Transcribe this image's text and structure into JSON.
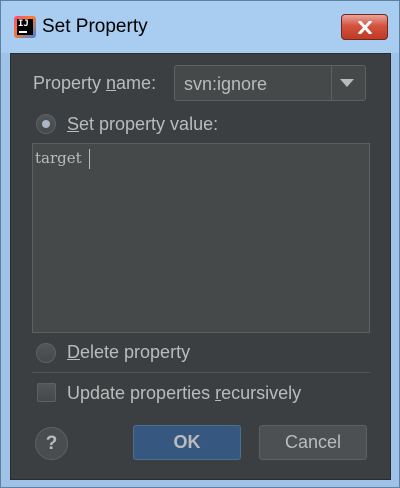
{
  "window": {
    "title": "Set Property",
    "app_icon_text": "IJ",
    "close_icon": "close-icon"
  },
  "property_name": {
    "label_before": "Property ",
    "label_mnemonic": "n",
    "label_after": "ame:",
    "selected_value": "svn:ignore",
    "dropdown_icon": "chevron-down-icon"
  },
  "set_value_option": {
    "label_mnemonic": "S",
    "label_after": "et property value:",
    "selected": true
  },
  "value_text": "target",
  "delete_option": {
    "label_mnemonic": "D",
    "label_after": "elete property",
    "selected": false
  },
  "recursive_option": {
    "label_before": "Update properties ",
    "label_mnemonic": "r",
    "label_after": "ecursively",
    "checked": false
  },
  "buttons": {
    "help": "?",
    "ok": "OK",
    "cancel": "Cancel"
  },
  "colors": {
    "dialog_background": "#3c3f41",
    "field_background": "#45494a",
    "text": "#bbbbbb",
    "ok_button": "#365880",
    "titlebar": "#a9cdf1",
    "close_button": "#c13a26"
  }
}
